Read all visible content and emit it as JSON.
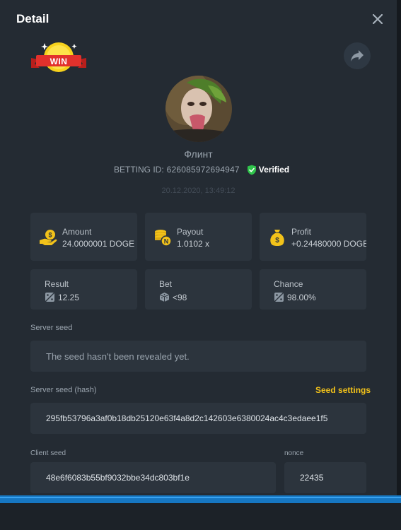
{
  "modal": {
    "title": "Detail",
    "close_icon": "close-icon",
    "share_icon": "share-arrow-icon"
  },
  "badge": {
    "text": "WIN",
    "icon": "win-badge-icon"
  },
  "user": {
    "name": "Флинт",
    "betting_id_label": "BETTING ID:",
    "betting_id": "626085972694947",
    "verified_label": "Verified",
    "timestamp": "20.12.2020, 13:49:12"
  },
  "stats": [
    {
      "label": "Amount",
      "value": "24.0000001 DOGE",
      "icon": "money-hand-icon"
    },
    {
      "label": "Payout",
      "value": "1.0102 x",
      "icon": "coin-stack-icon"
    },
    {
      "label": "Profit",
      "value": "+0.24480000 DOGE",
      "icon": "money-bag-icon"
    }
  ],
  "results": [
    {
      "label": "Result",
      "value": "12.25",
      "icon": "dice-icon"
    },
    {
      "label": "Bet",
      "value": "<98",
      "icon": "dice-cube-icon"
    },
    {
      "label": "Chance",
      "value": "98.00%",
      "icon": "dice-icon"
    }
  ],
  "server_seed": {
    "label": "Server seed",
    "value": "The seed hasn't been revealed yet."
  },
  "server_seed_hash": {
    "label": "Server seed (hash)",
    "value": "295fb53796a3af0b18db25120e63f4a8d2c142603e6380024ac4c3edaee1f5",
    "settings_link": "Seed settings"
  },
  "client_seed": {
    "label": "Client seed",
    "value": "48e6f6083b55bf9032bbe34dc803bf1e"
  },
  "nonce": {
    "label": "nonce",
    "value": "22435"
  },
  "colors": {
    "accent_yellow": "#f2c21a",
    "verified_green": "#2fc44b",
    "panel": "#242b33",
    "card": "#2c343d"
  }
}
